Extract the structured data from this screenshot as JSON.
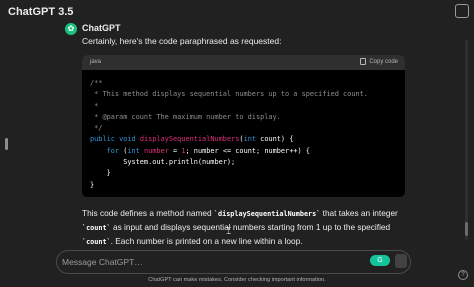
{
  "header": {
    "model_name": "ChatGPT 3.5",
    "model_chevron": "⌄"
  },
  "message": {
    "speaker": "ChatGPT",
    "avatar_glyph": "✿",
    "intro": "Certainly, here's the code paraphrased as requested:",
    "code_block": {
      "language": "java",
      "copy_label": "Copy code",
      "lines": [
        "/**",
        " * This method displays sequential numbers up to a specified count.",
        " *",
        " * @param count The maximum number to display.",
        " */",
        "public void displaySequentialNumbers(int count) {",
        "    for (int number = 1; number <= count; number++) {",
        "        System.out.println(number);",
        "    }",
        "}"
      ]
    },
    "summary": {
      "part1": "This code defines a method named ",
      "code1": "`displaySequentialNumbers`",
      "part2": " that takes an integer ",
      "code2": "`count`",
      "part3": " as input and displays sequential numbers starting from 1 up to the specified ",
      "code3": "`count`",
      "part4": ". Each number is printed on a new line within a loop."
    }
  },
  "composer": {
    "placeholder": "Message ChatGPT…"
  },
  "footer": {
    "disclaimer": "ChatGPT can make mistakes. Consider checking important information.",
    "help_label": "?"
  },
  "colors": {
    "background": "#212121",
    "code_background": "#000000",
    "code_header": "#2f2f2f",
    "keyword": "#2e95d3",
    "function_name": "#df3079",
    "comment": "#8e8e8e",
    "avatar": "#19c37d"
  }
}
